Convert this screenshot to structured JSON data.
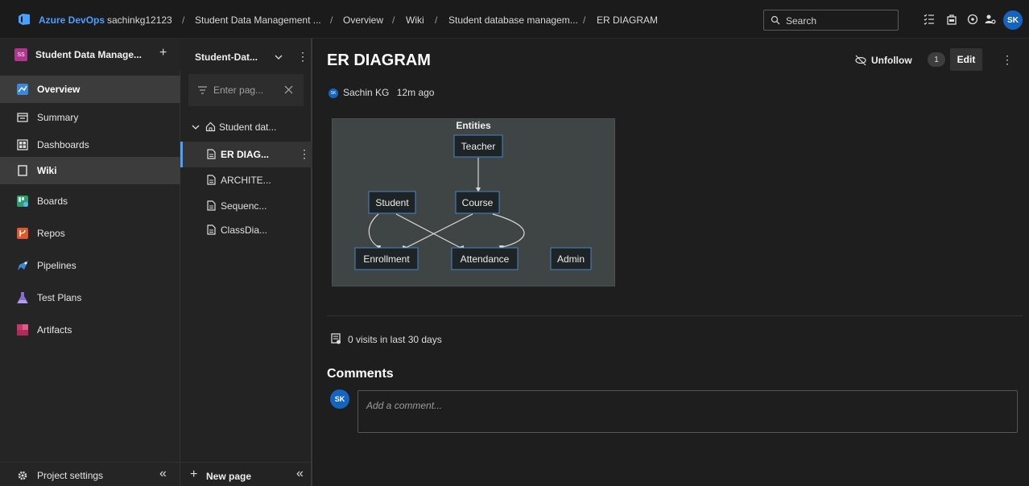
{
  "topbar": {
    "brand": "Azure DevOps",
    "breadcrumbs": [
      "sachinkg12123",
      "Student Data Management ...",
      "Overview",
      "Wiki",
      "Student database managem...",
      "ER DIAGRAM"
    ],
    "separator": "/",
    "search_label": "Search",
    "user_initials": "SK"
  },
  "leftnav": {
    "project_initials": "SS",
    "project_name": "Student Data Manage...",
    "add_symbol": "+",
    "items": [
      {
        "label": "Overview",
        "icon": "overview-icon"
      },
      {
        "label": "Summary",
        "icon": "summary-icon"
      },
      {
        "label": "Dashboards",
        "icon": "dashboards-icon"
      },
      {
        "label": "Wiki",
        "icon": "wiki-icon"
      },
      {
        "label": "Boards",
        "icon": "boards-icon"
      },
      {
        "label": "Repos",
        "icon": "repos-icon"
      },
      {
        "label": "Pipelines",
        "icon": "pipelines-icon"
      },
      {
        "label": "Test Plans",
        "icon": "test-plans-icon"
      },
      {
        "label": "Artifacts",
        "icon": "artifacts-icon"
      }
    ],
    "settings_label": "Project settings",
    "collapse_symbol": "«"
  },
  "wikitree": {
    "wiki_name": "Student-Dat...",
    "filter_placeholder": "Enter pag...",
    "root": "Student dat...",
    "pages": [
      "ER DIAG...",
      "ARCHITE...",
      "Sequenc...",
      "ClassDia..."
    ],
    "new_page_label": "New page",
    "collapse_symbol": "«"
  },
  "main": {
    "title": "ER DIAGRAM",
    "unfollow_label": "Unfollow",
    "follow_count": "1",
    "edit_label": "Edit",
    "more_symbol": "⋮",
    "author_initials": "SK",
    "author": "Sachin KG",
    "edited": "12m ago",
    "visits": "0 visits in last 30 days",
    "comments_title": "Comments",
    "comment_avatar": "SK",
    "comment_placeholder": "Add a comment..."
  },
  "diagram": {
    "title": "Entities",
    "nodes": [
      "Teacher",
      "Student",
      "Course",
      "Enrollment",
      "Attendance",
      "Admin"
    ]
  },
  "colors": {
    "accent": "#4aa0ff",
    "avatar_blue": "#1565c0",
    "diagram_bg": "#3f4444",
    "node_bg": "#1e2326",
    "node_border": "#4a86c8"
  }
}
